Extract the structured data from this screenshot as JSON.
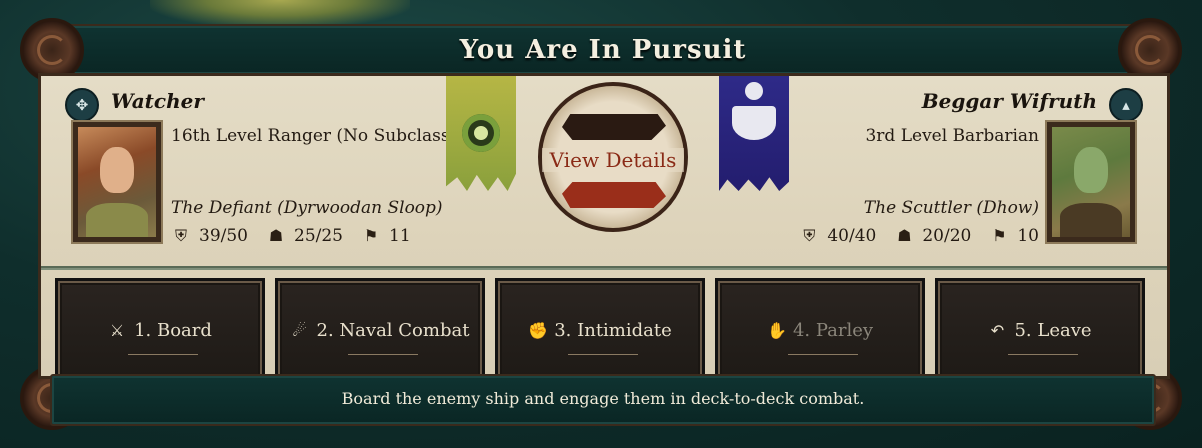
{
  "title": "You Are In Pursuit",
  "player": {
    "name": "Watcher",
    "description": "16th Level Ranger (No Subclass)",
    "ship": "The Defiant (Dyrwoodan Sloop)",
    "stats": {
      "hull": "39/50",
      "crew": "25/25",
      "sails": "11"
    },
    "badge_icon": "compass-icon"
  },
  "enemy": {
    "name": "Beggar Wifruth",
    "description": "3rd Level Barbarian",
    "ship": "The Scuttler (Dhow)",
    "stats": {
      "hull": "40/40",
      "crew": "20/20",
      "sails": "10"
    },
    "badge_icon": "chevron-up-icon"
  },
  "medallion": {
    "label": "View Details"
  },
  "options": [
    {
      "label": "1. Board",
      "icon": "crossed-swords-icon",
      "enabled": true
    },
    {
      "label": "2. Naval Combat",
      "icon": "cannon-icon",
      "enabled": true
    },
    {
      "label": "3. Intimidate",
      "icon": "fist-icon",
      "enabled": true
    },
    {
      "label": "4. Parley",
      "icon": "handshake-icon",
      "enabled": false
    },
    {
      "label": "5. Leave",
      "icon": "return-arrow-icon",
      "enabled": true
    }
  ],
  "option_description": "Board the enemy ship and engage them in deck-to-deck combat.",
  "colors": {
    "panel_dark": "#0f3331",
    "parchment": "#e4dcc6",
    "view_details_text": "#8a2a16"
  }
}
